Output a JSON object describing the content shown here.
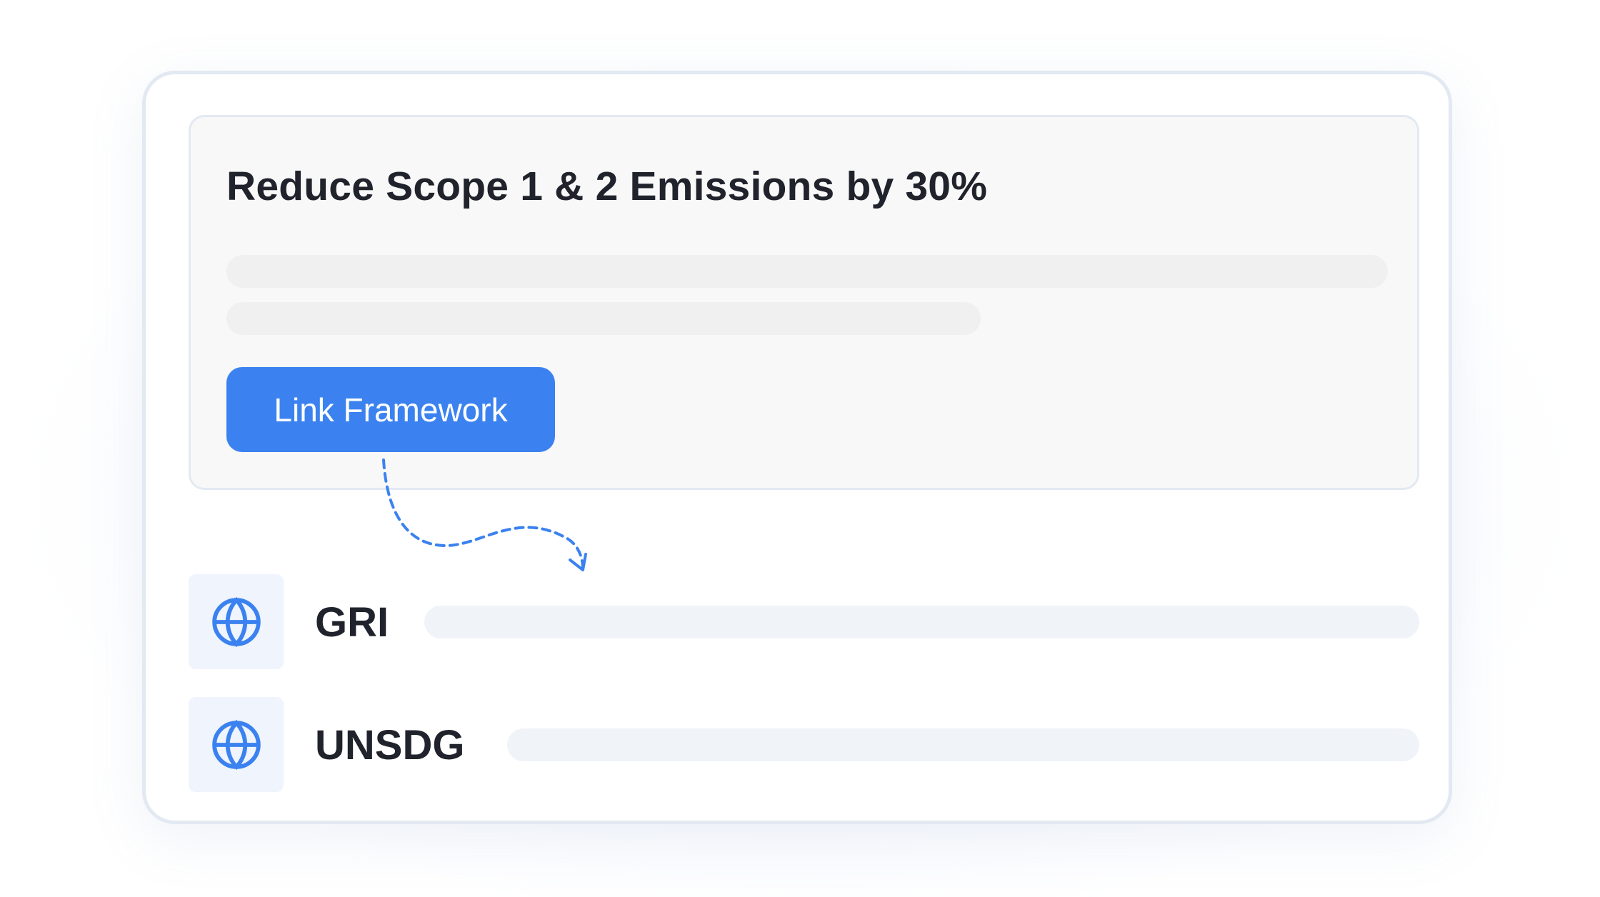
{
  "goal": {
    "title": "Reduce Scope 1 & 2 Emissions by 30%",
    "button_label": "Link Framework"
  },
  "frameworks": [
    {
      "label": "GRI",
      "icon": "globe-icon"
    },
    {
      "label": "UNSDG",
      "icon": "globe-icon"
    }
  ],
  "colors": {
    "accent": "#3b82f0",
    "text": "#20232b",
    "card_border": "#e3e9f2",
    "panel_bg": "#f8f8f9",
    "icon_tile_bg": "#eff4fd"
  }
}
